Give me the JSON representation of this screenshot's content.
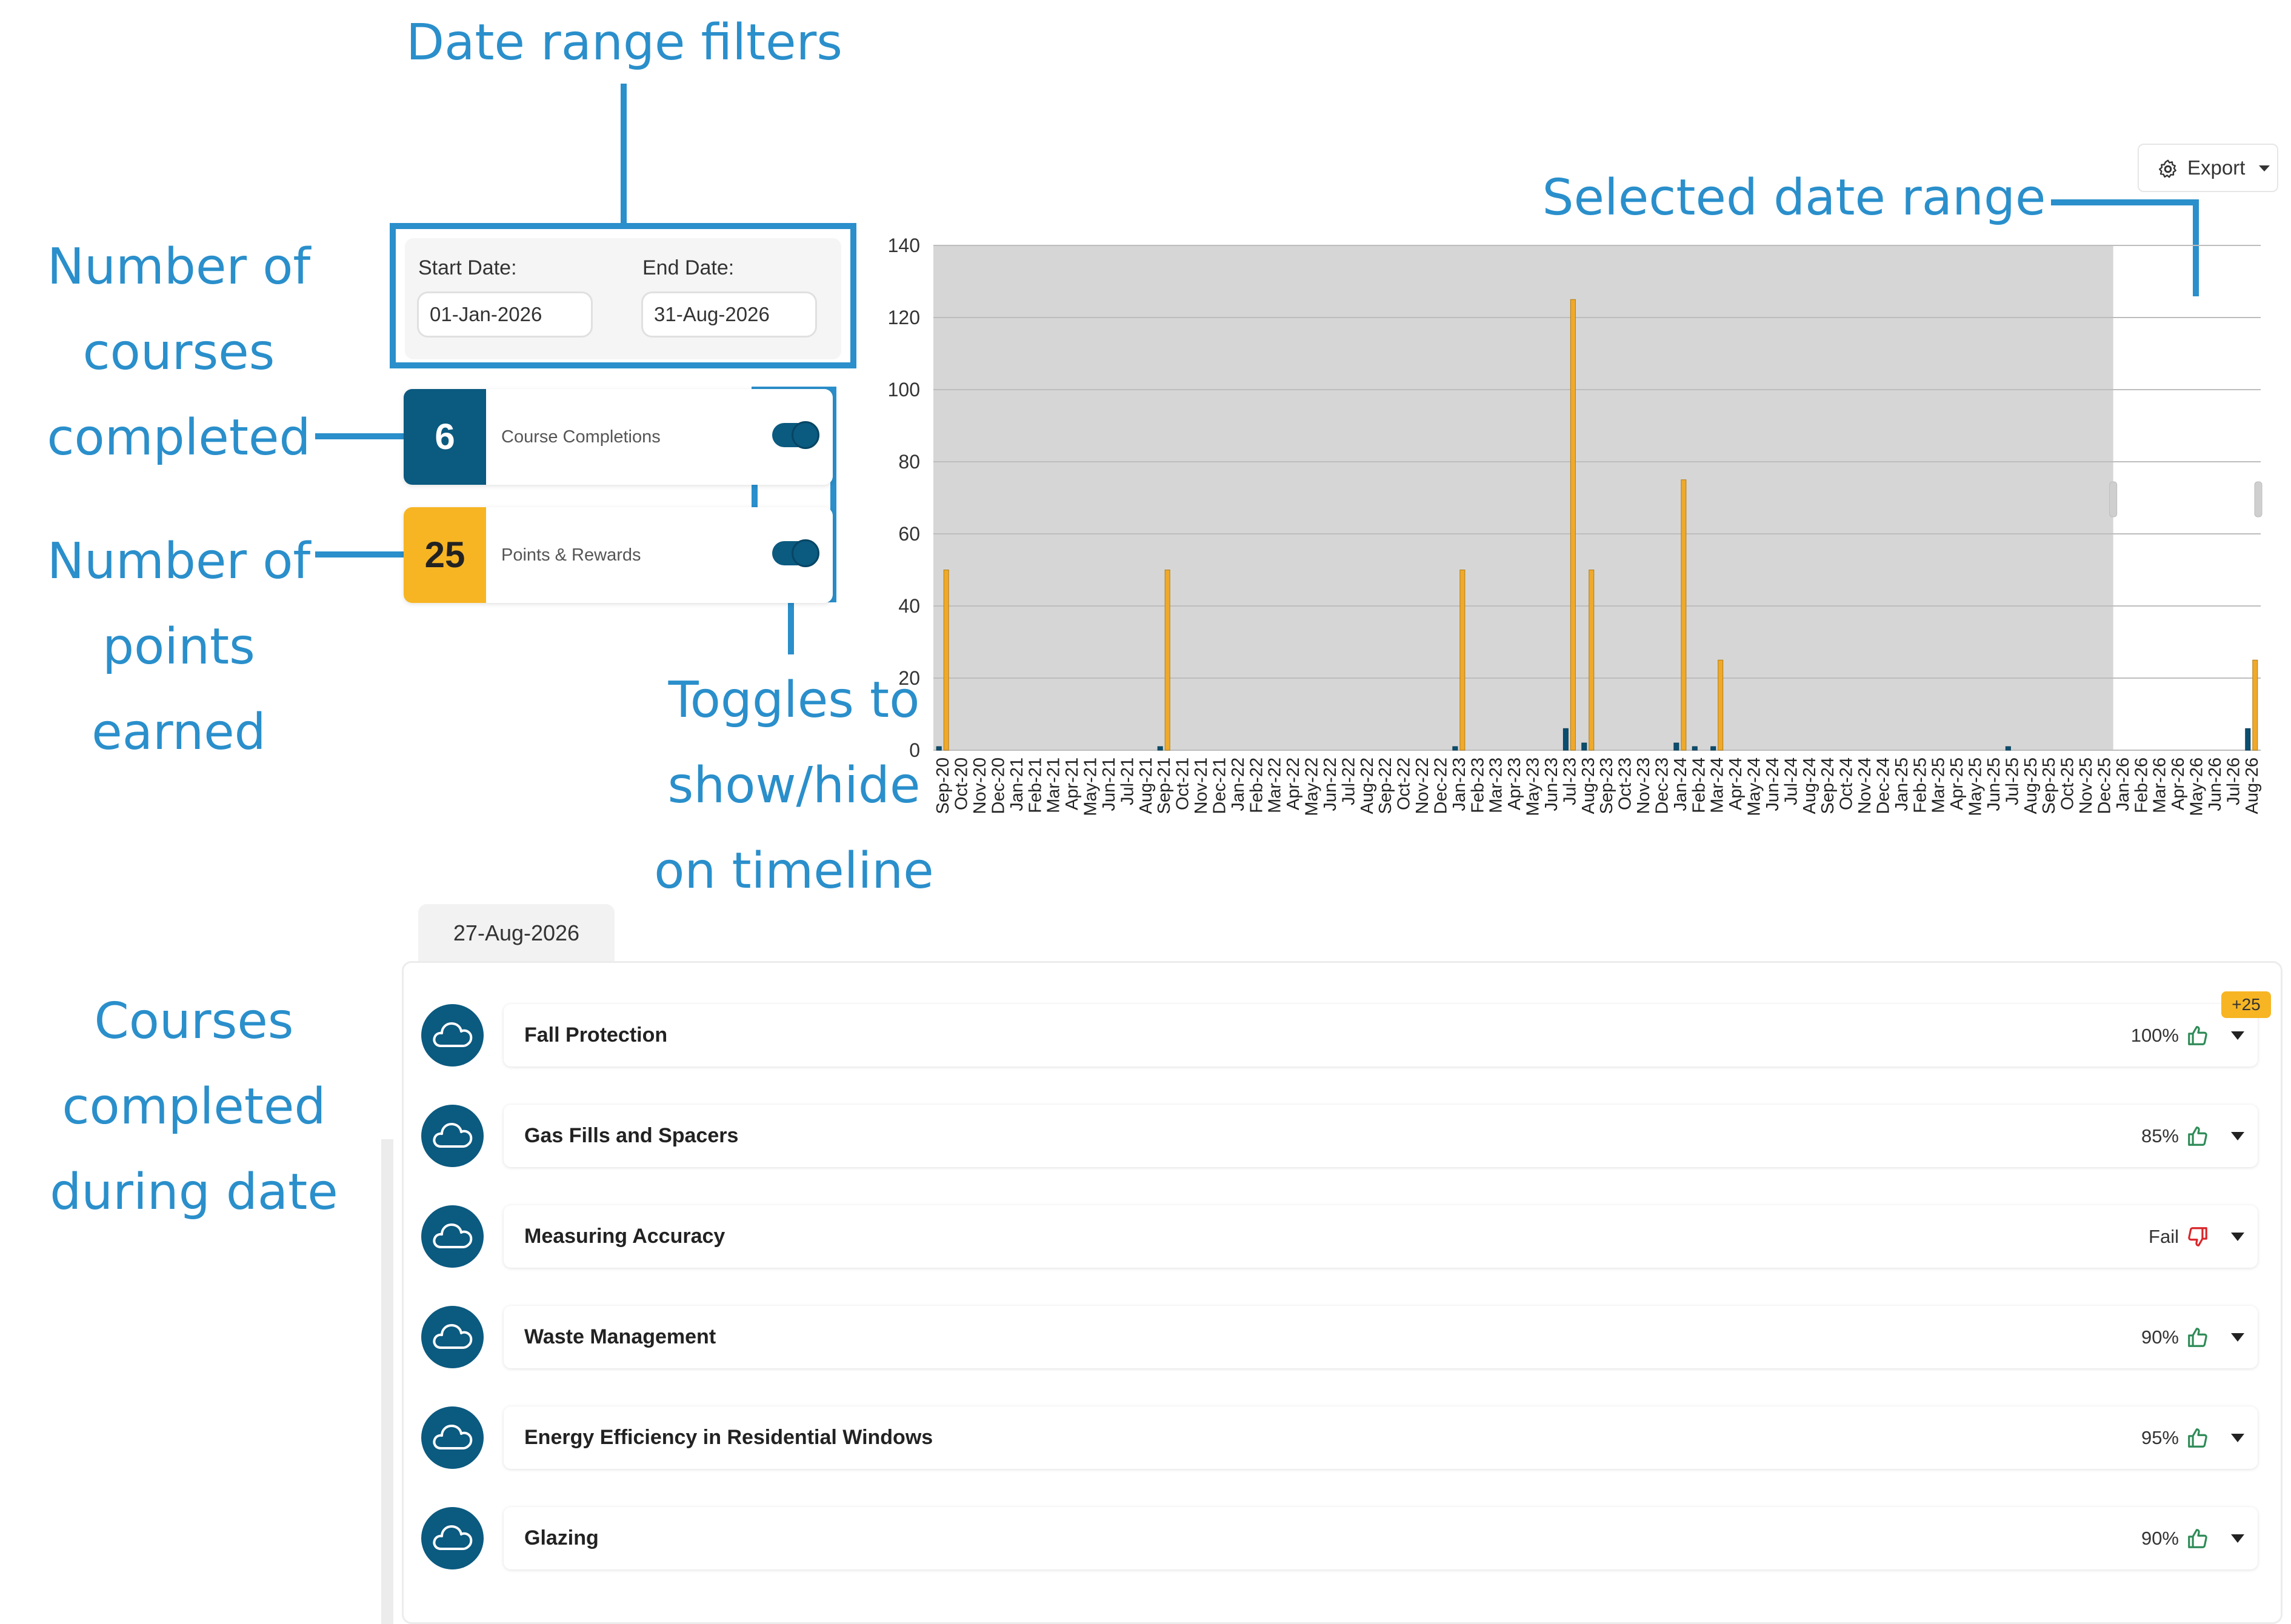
{
  "annotations": {
    "date_range_filters": "Date range filters",
    "selected_date_range": "Selected date range",
    "courses_completed_count": [
      "Number of",
      "courses",
      "completed"
    ],
    "points_earned": [
      "Number of",
      "points",
      "earned"
    ],
    "toggles": [
      "Toggles to",
      "show/hide",
      "on timeline"
    ],
    "courses_during_date": [
      "Courses",
      "completed",
      "during date"
    ]
  },
  "filters": {
    "start_label": "Start Date:",
    "start_value": "01-Jan-2026",
    "end_label": "End Date:",
    "end_value": "31-Aug-2026"
  },
  "stats": {
    "completions": {
      "value": "6",
      "label": "Course Completions",
      "color": "#0b5a80",
      "toggle_on": true
    },
    "points": {
      "value": "25",
      "label": "Points & Rewards",
      "color": "#f7b523",
      "toggle_on": true
    }
  },
  "toolbar": {
    "export_label": "Export",
    "export_icon": "gear-icon"
  },
  "chart_data": {
    "type": "bar",
    "ylim": [
      0,
      140
    ],
    "yticks": [
      0,
      20,
      40,
      60,
      80,
      100,
      120,
      140
    ],
    "grid": true,
    "categories": [
      "Sep-20",
      "Oct-20",
      "Nov-20",
      "Dec-20",
      "Jan-21",
      "Feb-21",
      "Mar-21",
      "Apr-21",
      "May-21",
      "Jun-21",
      "Jul-21",
      "Aug-21",
      "Sep-21",
      "Oct-21",
      "Nov-21",
      "Dec-21",
      "Jan-22",
      "Feb-22",
      "Mar-22",
      "Apr-22",
      "May-22",
      "Jun-22",
      "Jul-22",
      "Aug-22",
      "Sep-22",
      "Oct-22",
      "Nov-22",
      "Dec-22",
      "Jan-23",
      "Feb-23",
      "Mar-23",
      "Apr-23",
      "May-23",
      "Jun-23",
      "Jul-23",
      "Aug-23",
      "Sep-23",
      "Oct-23",
      "Nov-23",
      "Dec-23",
      "Jan-24",
      "Feb-24",
      "Mar-24",
      "Apr-24",
      "May-24",
      "Jun-24",
      "Jul-24",
      "Aug-24",
      "Sep-24",
      "Oct-24",
      "Nov-24",
      "Dec-24",
      "Jan-25",
      "Feb-25",
      "Mar-25",
      "Apr-25",
      "May-25",
      "Jun-25",
      "Jul-25",
      "Aug-25",
      "Sep-25",
      "Oct-25",
      "Nov-25",
      "Dec-25",
      "Jan-26",
      "Feb-26",
      "Mar-26",
      "Apr-26",
      "May-26",
      "Jun-26",
      "Jul-26",
      "Aug-26"
    ],
    "series": [
      {
        "color": "#0b4f70",
        "values": [
          1,
          0,
          0,
          0,
          0,
          0,
          0,
          0,
          0,
          0,
          0,
          0,
          1,
          0,
          0,
          0,
          0,
          0,
          0,
          0,
          0,
          0,
          0,
          0,
          0,
          0,
          0,
          0,
          1,
          0,
          0,
          0,
          0,
          0,
          6,
          2,
          0,
          0,
          0,
          0,
          2,
          1,
          1,
          0,
          0,
          0,
          0,
          0,
          0,
          0,
          0,
          0,
          0,
          0,
          0,
          0,
          0,
          0,
          1,
          0,
          0,
          0,
          0,
          0,
          0,
          0,
          0,
          0,
          0,
          0,
          0,
          6
        ]
      },
      {
        "color": "#f0a92a",
        "values": [
          50,
          0,
          0,
          0,
          0,
          0,
          0,
          0,
          0,
          0,
          0,
          0,
          50,
          0,
          0,
          0,
          0,
          0,
          0,
          0,
          0,
          0,
          0,
          0,
          0,
          0,
          0,
          0,
          50,
          0,
          0,
          0,
          0,
          0,
          125,
          50,
          0,
          0,
          0,
          0,
          75,
          0,
          25,
          0,
          0,
          0,
          0,
          0,
          0,
          0,
          0,
          0,
          0,
          0,
          0,
          0,
          0,
          0,
          0,
          0,
          0,
          0,
          0,
          0,
          0,
          0,
          0,
          0,
          0,
          0,
          0,
          25
        ]
      }
    ],
    "unselected_range": [
      "Sep-20",
      "Dec-25"
    ],
    "selected_range": [
      "Jan-26",
      "Aug-26"
    ]
  },
  "list": {
    "date_tab": "27-Aug-2026",
    "courses": [
      {
        "title": "Fall Protection",
        "score": "100%",
        "result": "pass",
        "badge": "+25"
      },
      {
        "title": "Gas Fills and Spacers",
        "score": "85%",
        "result": "pass"
      },
      {
        "title": "Measuring Accuracy",
        "score": "Fail",
        "result": "fail"
      },
      {
        "title": "Waste Management",
        "score": "90%",
        "result": "pass"
      },
      {
        "title": "Energy Efficiency in Residential Windows",
        "score": "95%",
        "result": "pass"
      },
      {
        "title": "Glazing",
        "score": "90%",
        "result": "pass"
      }
    ],
    "course_icon": "cloud-icon",
    "pass_icon": "thumbs-up-icon",
    "fail_icon": "thumbs-down-icon",
    "pass_color": "#2e8b57",
    "fail_color": "#d9262a"
  }
}
